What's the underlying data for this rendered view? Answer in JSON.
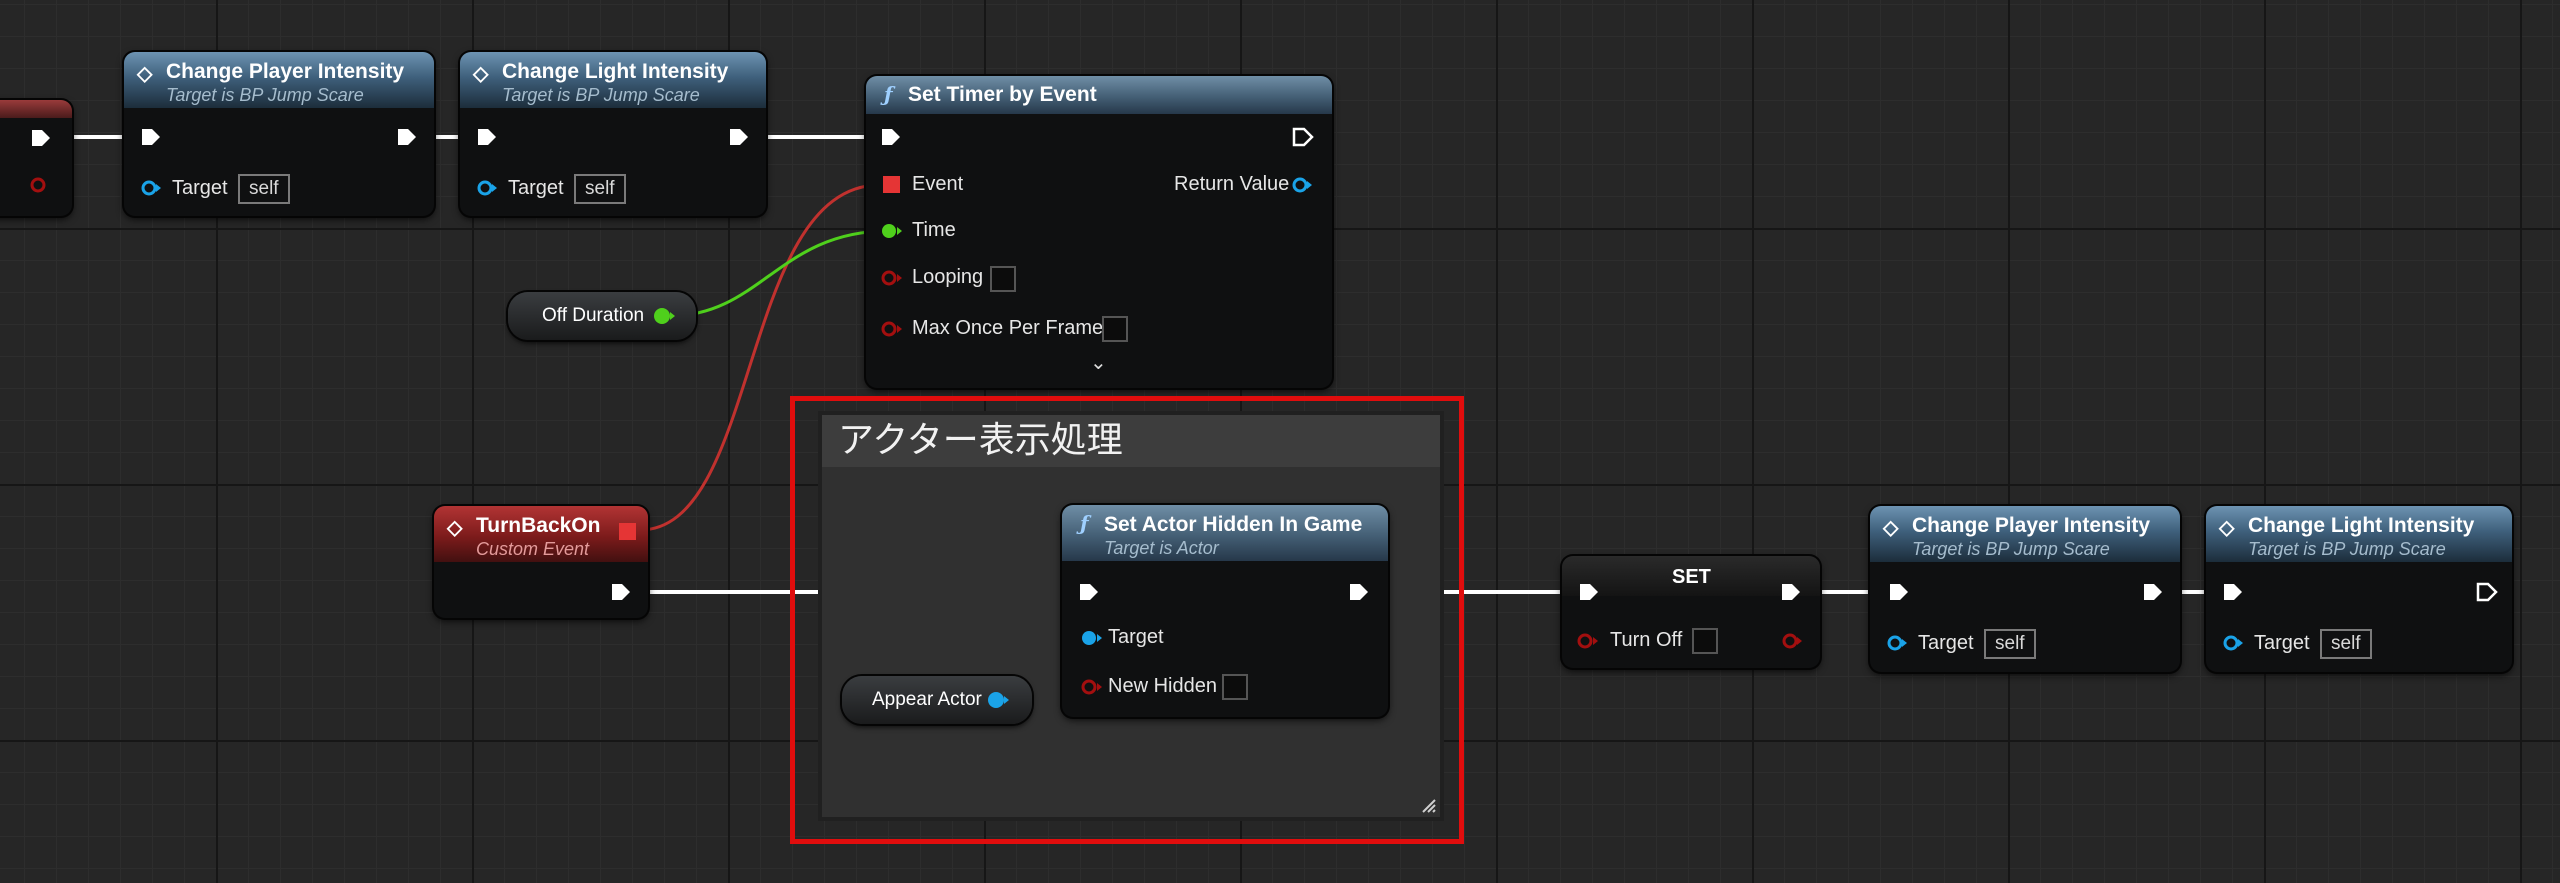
{
  "nodes": {
    "change_player_top": {
      "title": "Change Player Intensity",
      "subtitle": "Target is BP Jump Scare",
      "pin_target": "Target",
      "self_value": "self"
    },
    "change_light_top": {
      "title": "Change Light Intensity",
      "subtitle": "Target is BP Jump Scare",
      "pin_target": "Target",
      "self_value": "self"
    },
    "set_timer": {
      "title": "Set Timer by Event",
      "pin_event": "Event",
      "pin_time": "Time",
      "pin_looping": "Looping",
      "pin_max_once": "Max Once Per Frame",
      "pin_return": "Return Value",
      "expand_glyph": "⌄"
    },
    "off_duration": {
      "label": "Off Duration"
    },
    "turn_back_on": {
      "title": "TurnBackOn",
      "subtitle": "Custom Event"
    },
    "set_actor_hidden": {
      "title": "Set Actor Hidden In Game",
      "subtitle": "Target is Actor",
      "pin_target": "Target",
      "pin_new_hidden": "New Hidden"
    },
    "appear_actor": {
      "label": "Appear Actor"
    },
    "set_node": {
      "title": "SET",
      "pin_turn_off": "Turn Off"
    },
    "change_player_bottom": {
      "title": "Change Player Intensity",
      "subtitle": "Target is BP Jump Scare",
      "pin_target": "Target",
      "self_value": "self"
    },
    "change_light_bottom": {
      "title": "Change Light Intensity",
      "subtitle": "Target is BP Jump Scare",
      "pin_target": "Target",
      "self_value": "self"
    }
  },
  "comment": {
    "title": "アクター表示処理"
  },
  "icons": {
    "event_icon": "◇ diamond",
    "function_icon": "ƒ"
  },
  "colors": {
    "exec_wire": "#ffffff",
    "object_pin": "#1aa3e8",
    "float_pin": "#4fd01c",
    "bool_pin": "#a30f0f",
    "delegate_pin": "#e53535",
    "selection_outline": "#e00d0d",
    "event_header": "#8a2020",
    "function_header": "#4a6b87"
  }
}
